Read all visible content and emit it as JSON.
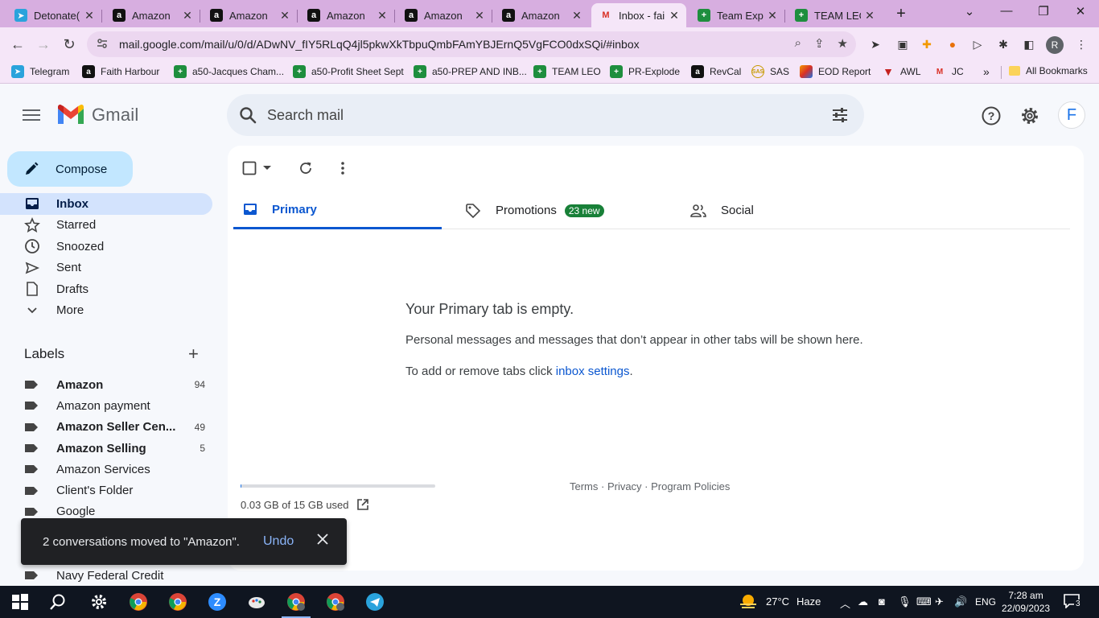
{
  "browser": {
    "tabs": [
      {
        "title": "Detonate(",
        "favicon": "telegram-icon"
      },
      {
        "title": "Amazon",
        "favicon": "amazon-icon"
      },
      {
        "title": "Amazon",
        "favicon": "amazon-icon"
      },
      {
        "title": "Amazon",
        "favicon": "amazon-icon"
      },
      {
        "title": "Amazon",
        "favicon": "amazon-icon"
      },
      {
        "title": "Amazon",
        "favicon": "amazon-icon"
      },
      {
        "title": "Inbox - fai",
        "favicon": "gmail-icon",
        "active": true
      },
      {
        "title": "Team Explo",
        "favicon": "sheets-icon"
      },
      {
        "title": "TEAM LEO",
        "favicon": "sheets-icon"
      }
    ],
    "url": "mail.google.com/mail/u/0/d/ADwNV_fIY5RLqQ4jl5pkwXkTbpuQmbFAmYBJErnQ5VgFCO0dxSQi/#inbox",
    "profile_initial": "R",
    "bookmarks": [
      {
        "label": "Telegram",
        "icon": "telegram-icon"
      },
      {
        "label": "Faith Harbour",
        "icon": "amazon-icon"
      },
      {
        "label": "a50-Jacques Cham...",
        "icon": "sheets-icon"
      },
      {
        "label": "a50-Profit Sheet Sept",
        "icon": "sheets-icon"
      },
      {
        "label": "a50-PREP AND INB...",
        "icon": "sheets-icon"
      },
      {
        "label": "TEAM LEO",
        "icon": "sheets-icon"
      },
      {
        "label": "PR-Explode",
        "icon": "sheets-icon"
      },
      {
        "label": "RevCal",
        "icon": "amazon-icon"
      },
      {
        "label": "SAS",
        "icon": "sas-icon"
      },
      {
        "label": "EOD Report",
        "icon": "eod-icon"
      },
      {
        "label": "AWL",
        "icon": "awl-icon"
      },
      {
        "label": "JC",
        "icon": "gmail-icon"
      }
    ],
    "bookmarks_overflow": "»",
    "all_bookmarks": "All Bookmarks"
  },
  "gmail": {
    "logo_text": "Gmail",
    "search_placeholder": "Search mail",
    "account_initial": "F",
    "compose_label": "Compose",
    "nav": [
      {
        "label": "Inbox",
        "icon": "inbox-icon",
        "active": true
      },
      {
        "label": "Starred",
        "icon": "star-icon"
      },
      {
        "label": "Snoozed",
        "icon": "clock-icon"
      },
      {
        "label": "Sent",
        "icon": "send-icon"
      },
      {
        "label": "Drafts",
        "icon": "draft-icon"
      },
      {
        "label": "More",
        "icon": "chevron-down-icon"
      }
    ],
    "labels_title": "Labels",
    "labels": [
      {
        "name": "Amazon",
        "count": "94",
        "bold": true
      },
      {
        "name": "Amazon payment",
        "count": "",
        "bold": false
      },
      {
        "name": "Amazon Seller Cen...",
        "count": "49",
        "bold": true
      },
      {
        "name": "Amazon Selling",
        "count": "5",
        "bold": true
      },
      {
        "name": "Amazon Services",
        "count": "",
        "bold": false
      },
      {
        "name": "Client's Folder",
        "count": "",
        "bold": false
      },
      {
        "name": "Google",
        "count": "",
        "bold": false
      }
    ],
    "labels_after_snackbar": [
      {
        "name": "Navy Federal Credit",
        "count": "",
        "bold": false
      }
    ],
    "tabs": [
      {
        "label": "Primary",
        "icon": "inbox-tab-icon"
      },
      {
        "label": "Promotions",
        "icon": "tag-icon",
        "badge": "23 new"
      },
      {
        "label": "Social",
        "icon": "people-icon"
      }
    ],
    "empty_title": "Your Primary tab is empty.",
    "empty_message": "Personal messages and messages that don’t appear in other tabs will be shown here.",
    "settings_prefix": "To add or remove tabs click ",
    "settings_link": "inbox settings",
    "settings_suffix": ".",
    "storage_text": "0.03 GB of 15 GB used",
    "storage_fraction": 0.002,
    "footer_links": "Terms · Privacy · Program Policies",
    "snackbar_text": "2 conversations moved to \"Amazon\".",
    "snackbar_action": "Undo"
  },
  "taskbar": {
    "weather_temp": "27°C",
    "weather_desc": "Haze",
    "language": "ENG",
    "time": "7:28 am",
    "date": "22/09/2023",
    "notification_count": "3"
  },
  "colors": {
    "chrome_frame": "#d7aee0",
    "compose_bg": "#c2e7ff",
    "active_nav": "#d3e3fd",
    "primary_blue": "#0b57d0",
    "promo_badge": "#188038"
  }
}
